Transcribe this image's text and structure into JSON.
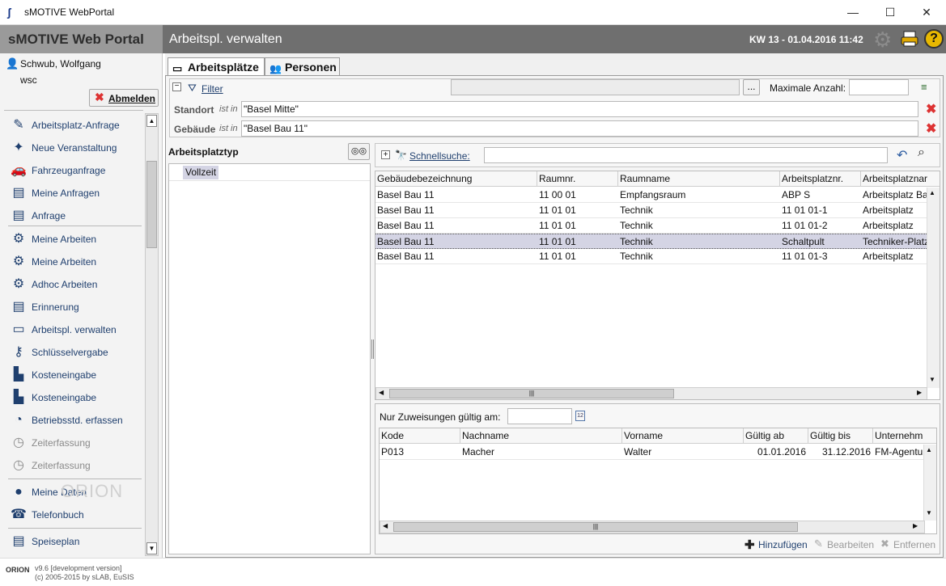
{
  "window": {
    "title": "sMOTIVE WebPortal",
    "minimize": "—",
    "maximize": "☐",
    "close": "✕"
  },
  "header": {
    "brand": "sMOTIVE Web Portal",
    "page_title": "Arbeitspl. verwalten",
    "week_date": "KW 13 - 01.04.2016 11:42",
    "help": "?"
  },
  "user": {
    "name": "Schwub, Wolfgang",
    "login": "wsc",
    "logout_label": "Abmelden"
  },
  "nav": {
    "items": [
      {
        "label": "Arbeitsplatz-Anfrage",
        "icon": "✎"
      },
      {
        "label": "Neue Veranstaltung",
        "icon": "✦"
      },
      {
        "label": "Fahrzeuganfrage",
        "icon": "🚗"
      },
      {
        "label": "Meine Anfragen",
        "icon": "▤"
      },
      {
        "label": "Anfrage",
        "icon": "▤"
      }
    ],
    "items2": [
      {
        "label": "Meine Arbeiten",
        "icon": "⚙"
      },
      {
        "label": "Meine Arbeiten",
        "icon": "⚙"
      },
      {
        "label": "Adhoc Arbeiten",
        "icon": "⚙"
      },
      {
        "label": "Erinnerung",
        "icon": "▤"
      },
      {
        "label": "Arbeitspl. verwalten",
        "icon": "▭"
      },
      {
        "label": "Schlüsselvergabe",
        "icon": "⚷"
      },
      {
        "label": "Kosteneingabe",
        "icon": "▙"
      },
      {
        "label": "Kosteneingabe",
        "icon": "▙"
      },
      {
        "label": "Betriebsstd. erfassen",
        "icon": "◔"
      },
      {
        "label": "Zeiterfassung",
        "icon": "◷"
      },
      {
        "label": "Zeiterfassung",
        "icon": "◷"
      }
    ],
    "items3": [
      {
        "label": "Meine Daten",
        "icon": "●"
      },
      {
        "label": "Telefonbuch",
        "icon": "☎"
      }
    ],
    "items4": [
      {
        "label": "Speiseplan",
        "icon": "▤"
      }
    ],
    "watermark": "ORION"
  },
  "footer": {
    "version": "v9.6 [development version]",
    "copyright": "(c) 2005-2015 by sLAB, EuSIS",
    "logo_text": "ORION"
  },
  "tabs": [
    {
      "label": "Arbeitsplätze"
    },
    {
      "label": "Personen"
    }
  ],
  "filter": {
    "label": "Filter",
    "collapse": "−",
    "dots": "...",
    "max_label": "Maximale Anzahl:",
    "max_value": "",
    "rows": [
      {
        "field": "Standort",
        "op": "ist in",
        "value": "\"Basel Mitte\""
      },
      {
        "field": "Gebäude",
        "op": "ist in",
        "value": "\"Basel Bau 11\""
      }
    ]
  },
  "type_panel": {
    "title": "Arbeitsplatztyp",
    "items": [
      "Vollzeit"
    ]
  },
  "quicksearch": {
    "expand": "+",
    "label": "Schnellsuche:",
    "value": ""
  },
  "workplaces": {
    "columns": [
      "Gebäudebezeichnung",
      "Raumnr.",
      "Raumname",
      "Arbeitsplatznr.",
      "Arbeitsplatznar"
    ],
    "rows": [
      [
        "Basel Bau 11",
        "11 00 01",
        "Empfangsraum",
        "ABP S",
        "Arbeitsplatz Ba"
      ],
      [
        "Basel Bau 11",
        "11 01 01",
        "Technik",
        "11 01 01-1",
        "Arbeitsplatz"
      ],
      [
        "Basel Bau 11",
        "11 01 01",
        "Technik",
        "11 01 01-2",
        "Arbeitsplatz"
      ],
      [
        "Basel Bau 11",
        "11 01 01",
        "Technik",
        "Schaltpult",
        "Techniker-Platz"
      ],
      [
        "Basel Bau 11",
        "11 01 01",
        "Technik",
        "11 01 01-3",
        "Arbeitsplatz"
      ]
    ],
    "selected_index": 3
  },
  "assignments": {
    "date_label": "Nur Zuweisungen gültig am:",
    "date_value": "",
    "date_icon_text": "12",
    "columns": [
      "Kode",
      "Nachname",
      "Vorname",
      "Gültig ab",
      "Gültig bis",
      "Unternehm"
    ],
    "rows": [
      [
        "P013",
        "Macher",
        "Walter",
        "01.01.2016",
        "31.12.2016",
        "FM-Agentur"
      ]
    ]
  },
  "actions": {
    "add": "Hinzufügen",
    "edit": "Bearbeiten",
    "remove": "Entfernen"
  },
  "colors": {
    "header_dark": "#6f6f6f",
    "header_light": "#9a9a9a",
    "link": "#1f3f6e",
    "selection": "#d4d4e4",
    "danger": "#d33333"
  }
}
